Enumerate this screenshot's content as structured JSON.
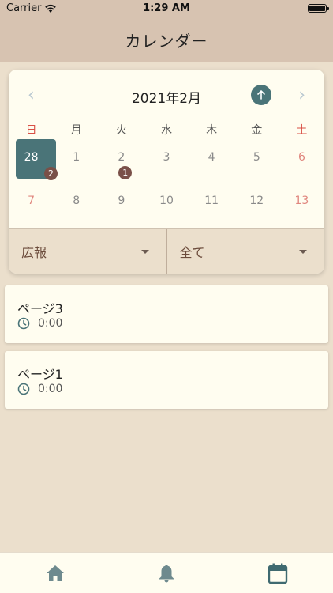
{
  "status_bar": {
    "carrier": "Carrier",
    "time": "1:29 AM"
  },
  "nav": {
    "title": "カレンダー"
  },
  "calendar": {
    "month_label": "2021年2月",
    "weekdays": [
      "日",
      "月",
      "火",
      "水",
      "木",
      "金",
      "土"
    ],
    "week1": [
      "28",
      "1",
      "2",
      "3",
      "4",
      "5",
      "6"
    ],
    "week2": [
      "7",
      "8",
      "9",
      "10",
      "11",
      "12",
      "13"
    ],
    "badges": {
      "day28": "2",
      "day2": "1"
    }
  },
  "filters": {
    "category": "広報",
    "scope": "全て"
  },
  "events": [
    {
      "title": "ページ3",
      "time": "0:00"
    },
    {
      "title": "ページ1",
      "time": "0:00"
    }
  ],
  "colors": {
    "accent": "#4a7478",
    "badge": "#7a5048",
    "header_bg": "#d7c3b1",
    "page_bg": "#ebdfcc"
  }
}
